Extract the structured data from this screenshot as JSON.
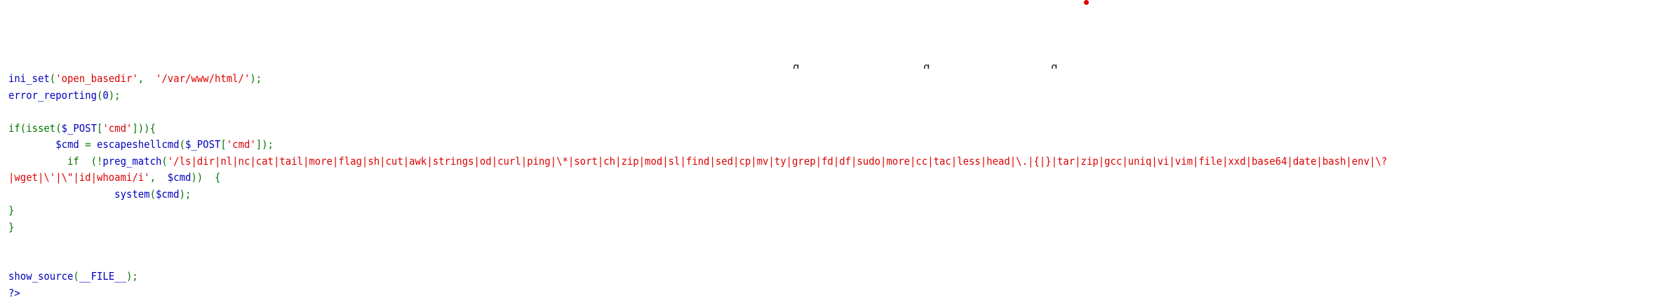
{
  "colors": {
    "default": "#0000BB",
    "keyword": "#007700",
    "string": "#DD0000",
    "background": "#FFFFFF"
  },
  "top_cutoff_fragments": [
    ",",
    "_ _ _",
    "g_",
    "g_",
    "g,",
    ", , ,"
  ],
  "lines": [
    {
      "segments": [
        {
          "text": "ini_set",
          "t": "d"
        },
        {
          "text": "(",
          "t": "k"
        },
        {
          "text": "'open_basedir'",
          "t": "s"
        },
        {
          "text": ",  ",
          "t": "k"
        },
        {
          "text": "'/var/www/html/'",
          "t": "s"
        },
        {
          "text": ");",
          "t": "k"
        }
      ]
    },
    {
      "segments": [
        {
          "text": "error_reporting",
          "t": "d"
        },
        {
          "text": "(",
          "t": "k"
        },
        {
          "text": "0",
          "t": "d"
        },
        {
          "text": ");",
          "t": "k"
        }
      ]
    },
    {
      "segments": []
    },
    {
      "segments": [
        {
          "text": "if(isset(",
          "t": "k"
        },
        {
          "text": "$_POST",
          "t": "d"
        },
        {
          "text": "[",
          "t": "k"
        },
        {
          "text": "'cmd'",
          "t": "s"
        },
        {
          "text": "])){",
          "t": "k"
        }
      ]
    },
    {
      "segments": [
        {
          "text": "        ",
          "t": "k"
        },
        {
          "text": "$cmd ",
          "t": "d"
        },
        {
          "text": "= ",
          "t": "k"
        },
        {
          "text": "escapeshellcmd",
          "t": "d"
        },
        {
          "text": "(",
          "t": "k"
        },
        {
          "text": "$_POST",
          "t": "d"
        },
        {
          "text": "[",
          "t": "k"
        },
        {
          "text": "'cmd'",
          "t": "s"
        },
        {
          "text": "]);",
          "t": "k"
        }
      ]
    },
    {
      "segments": [
        {
          "text": "          if  (!",
          "t": "k"
        },
        {
          "text": "preg_match",
          "t": "d"
        },
        {
          "text": "(",
          "t": "k"
        },
        {
          "text": "'/ls|dir|nl|nc|cat|tail|more|flag|sh|cut|awk|strings|od|curl|ping|\\*|sort|ch|zip|mod|sl|find|sed|cp|mv|ty|grep|fd|df|sudo|more|cc|tac|less|head|\\.|{|}|tar|zip|gcc|uniq|vi|vim|file|xxd|base64|date|bash|env|\\?",
          "t": "s"
        }
      ]
    },
    {
      "segments": [
        {
          "text": "|wget|\\'|\\\"|id|whoami/i'",
          "t": "s"
        },
        {
          "text": ",  ",
          "t": "k"
        },
        {
          "text": "$cmd",
          "t": "d"
        },
        {
          "text": "))  {",
          "t": "k"
        }
      ]
    },
    {
      "segments": [
        {
          "text": "                  ",
          "t": "k"
        },
        {
          "text": "system",
          "t": "d"
        },
        {
          "text": "(",
          "t": "k"
        },
        {
          "text": "$cmd",
          "t": "d"
        },
        {
          "text": ");",
          "t": "k"
        }
      ]
    },
    {
      "segments": [
        {
          "text": "}",
          "t": "k"
        }
      ]
    },
    {
      "segments": [
        {
          "text": "}",
          "t": "k"
        }
      ]
    },
    {
      "segments": []
    },
    {
      "segments": []
    },
    {
      "segments": [
        {
          "text": "show_source",
          "t": "d"
        },
        {
          "text": "(",
          "t": "k"
        },
        {
          "text": "__FILE__",
          "t": "d"
        },
        {
          "text": ");",
          "t": "k"
        }
      ]
    },
    {
      "segments": [
        {
          "text": "?>",
          "t": "d"
        }
      ]
    }
  ]
}
